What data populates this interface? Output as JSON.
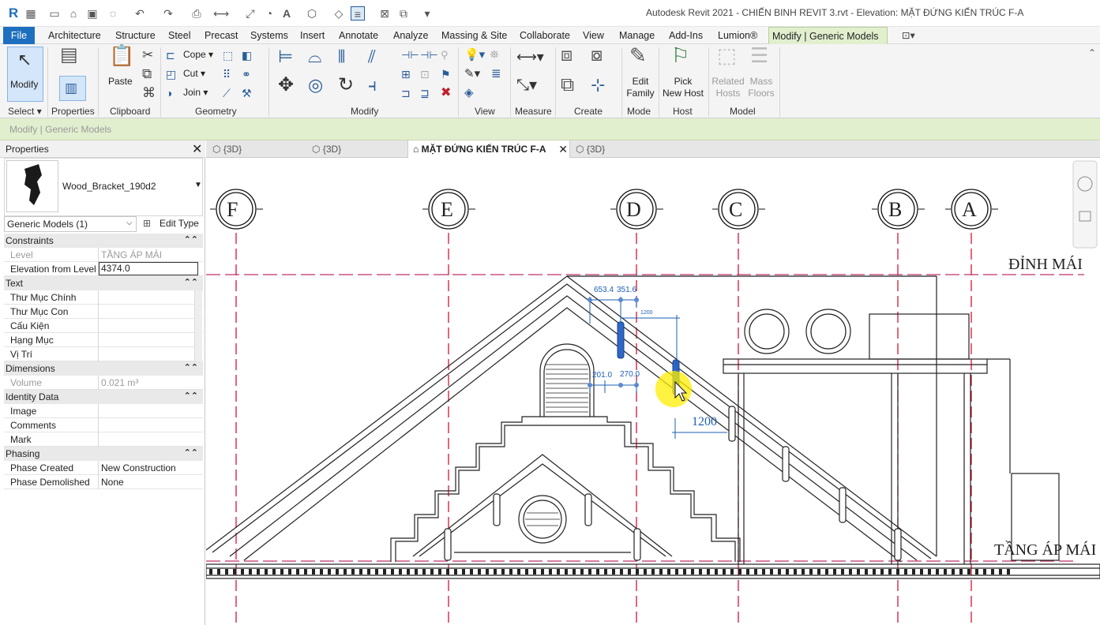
{
  "app": {
    "logo": "R",
    "title": "Autodesk Revit 2021 - CHIẾN BINH REVIT 3.rvt - Elevation: MẶT ĐỨNG KIẾN TRÚC F-A"
  },
  "menu": [
    "File",
    "Architecture",
    "Structure",
    "Steel",
    "Precast",
    "Systems",
    "Insert",
    "Annotate",
    "Analyze",
    "Massing & Site",
    "Collaborate",
    "View",
    "Manage",
    "Add-Ins",
    "Lumion®",
    "Modify | Generic Models"
  ],
  "ribbon": {
    "modify": "Modify",
    "paste": "Paste",
    "cope": "Cope",
    "cut": "Cut",
    "join": "Join",
    "edit_family": [
      "Edit",
      "Family"
    ],
    "pick_new_host": [
      "Pick",
      "New Host"
    ],
    "related_hosts": [
      "Related",
      "Hosts"
    ],
    "mass_floors": [
      "Mass",
      "Floors"
    ],
    "panels": [
      "Select",
      "Properties",
      "Clipboard",
      "Geometry",
      "Modify",
      "View",
      "Measure",
      "Create",
      "Mode",
      "Host",
      "Model"
    ]
  },
  "context_bar": "Modify | Generic Models",
  "properties": {
    "title": "Properties",
    "type_name": "Wood_Bracket_190d2",
    "filter": "Generic Models (1)",
    "edit_type": "Edit Type",
    "groups": {
      "constraints": "Constraints",
      "text": "Text",
      "dimensions": "Dimensions",
      "identity": "Identity Data",
      "phasing": "Phasing"
    },
    "rows": {
      "level": {
        "k": "Level",
        "v": "TẦNG ÁP MÁI"
      },
      "elev": {
        "k": "Elevation from Level",
        "v": "4374.0"
      },
      "thu_muc_chinh": {
        "k": "Thư Mục Chính",
        "v": ""
      },
      "thu_muc_con": {
        "k": "Thư Mục Con",
        "v": ""
      },
      "cau_kien": {
        "k": "Cấu Kiện",
        "v": ""
      },
      "hang_muc": {
        "k": "Hạng Mục",
        "v": ""
      },
      "vi_tri": {
        "k": "Vị Trí",
        "v": ""
      },
      "volume": {
        "k": "Volume",
        "v": "0.021 m³"
      },
      "image": {
        "k": "Image",
        "v": ""
      },
      "comments": {
        "k": "Comments",
        "v": ""
      },
      "mark": {
        "k": "Mark",
        "v": ""
      },
      "phase_created": {
        "k": "Phase Created",
        "v": "New Construction"
      },
      "phase_demolished": {
        "k": "Phase Demolished",
        "v": "None"
      }
    }
  },
  "doc_tabs": [
    "{3D}",
    "{3D}",
    "MẶT ĐỨNG KIẾN TRÚC F-A",
    "{3D}"
  ],
  "drawing": {
    "grid_labels": [
      "F",
      "E",
      "D",
      "C",
      "B",
      "A"
    ],
    "level_top": "ĐỈNH MÁI",
    "level_bottom": "TẦNG ÁP MÁI",
    "dims": [
      "653.4",
      "351.6",
      "1200",
      "201.0",
      "270.0",
      "1200"
    ]
  },
  "colors": {
    "accent": "#1f6fbf",
    "context": "#e2efcf",
    "grid_line": "#d0002a",
    "dimension": "#1a5fb4"
  }
}
